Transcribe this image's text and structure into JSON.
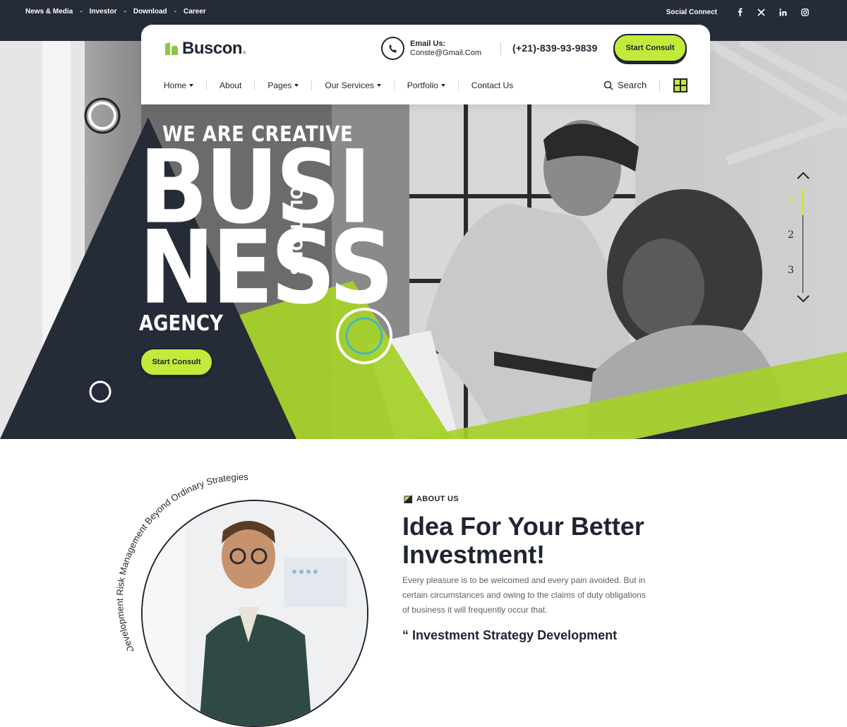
{
  "topbar": {
    "links": [
      "News & Media",
      "Investor",
      "Download",
      "Career"
    ],
    "social_label": "Social Connect",
    "social_icons": [
      "facebook-icon",
      "x-icon",
      "linkedin-icon",
      "instagram-icon"
    ]
  },
  "header": {
    "logo_text": "Buscon",
    "email_label": "Email Us:",
    "email_address": "Conste@Gmail.Com",
    "phone": "(+21)-839-93-9839",
    "cta": "Start Consult",
    "nav": [
      {
        "label": "Home",
        "dropdown": true
      },
      {
        "label": "About",
        "dropdown": false
      },
      {
        "label": "Pages",
        "dropdown": true
      },
      {
        "label": "Our Services",
        "dropdown": true
      },
      {
        "label": "Portfolio",
        "dropdown": true
      },
      {
        "label": "Contact Us",
        "dropdown": false
      }
    ],
    "search_label": "Search"
  },
  "hero": {
    "kicker": "WE ARE CREATIVE",
    "line1": "BUSI",
    "line2": "NESS",
    "vertical": "SOLUTIONS",
    "line3": "AGENCY",
    "cta": "Start Consult",
    "slides": [
      "1",
      "2",
      "3"
    ],
    "active_slide": 1
  },
  "about": {
    "curved_text": "Development Risk Management Beyond Ordinary Strategies",
    "tag": "ABOUT US",
    "title_line1": "Idea For Your Better",
    "title_line2": "Investment!",
    "text": "Every pleasure is to be welcomed and every pain avoided. But in certain circumstances and owing to the claims of duty obligations of business it will frequently occur that.",
    "subheading": "Investment Strategy Development"
  },
  "colors": {
    "dark": "#252b37",
    "accent": "#c2ea3b",
    "green": "#8dc63f"
  }
}
